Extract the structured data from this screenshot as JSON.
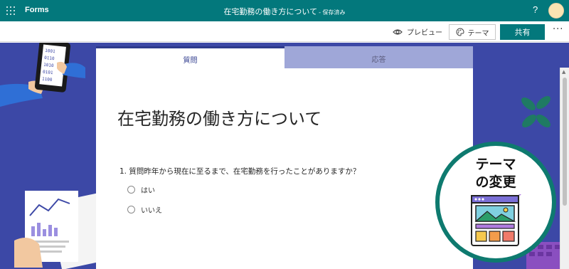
{
  "app": {
    "name": "Forms",
    "doc_title": "在宅勤務の働き方について",
    "save_status": "- 保存済み",
    "help": "?"
  },
  "commands": {
    "preview": "プレビュー",
    "theme": "テーマ",
    "share": "共有",
    "more": "···"
  },
  "tabs": {
    "questions": "質問",
    "responses": "応答"
  },
  "form": {
    "title": "在宅勤務の働き方について",
    "question": "1. 質問昨年から現在に至るまで、在宅勤務を行ったことがありますか？",
    "options": [
      "はい",
      "いいえ"
    ]
  },
  "callout": {
    "line1": "テーマ",
    "line2": "の変更"
  },
  "colors": {
    "brand": "#03787c",
    "background": "#3c48a6",
    "tab_active": "#2d3a8c",
    "tab_inactive": "#9fa7d8",
    "callout_ring": "#0e7a6f"
  }
}
